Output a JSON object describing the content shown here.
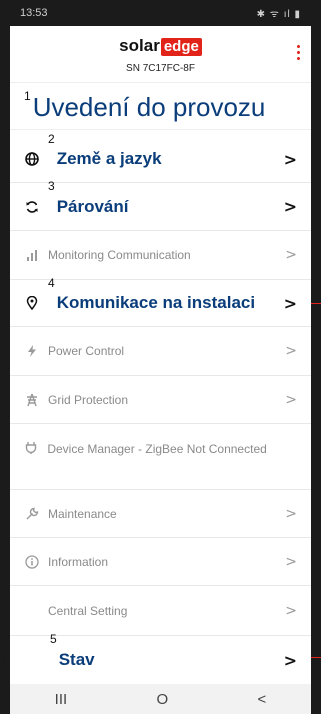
{
  "status_bar": {
    "time": "13:53",
    "icons": "✱ ᯤ ıl ▮"
  },
  "header": {
    "logo_solar": "solar",
    "logo_edge": "edge",
    "serial": "SN 7C17FC-8F"
  },
  "page": {
    "annotation": "1",
    "title": "Uvedení do provozu"
  },
  "menu": {
    "country": {
      "annotation": "2",
      "label": "Země a jazyk"
    },
    "pairing": {
      "annotation": "3",
      "label": "Párování"
    },
    "monitoring": {
      "label": "Monitoring Communication"
    },
    "site_comm": {
      "annotation": "4",
      "label": "Komunikace na instalaci"
    },
    "power_control": {
      "label": "Power Control"
    },
    "grid_protection": {
      "label": "Grid Protection"
    },
    "device_manager": {
      "label": "Device Manager - ZigBee Not Connected"
    },
    "maintenance": {
      "label": "Maintenance"
    },
    "information": {
      "label": "Information"
    },
    "central_setting": {
      "label": "Central Setting"
    },
    "status": {
      "annotation": "5",
      "label": "Stav"
    }
  },
  "nav_bar": {
    "recents": "III",
    "home": "O",
    "back": "<"
  },
  "colors": {
    "accent": "#e2231a",
    "title": "#0a3d7a",
    "muted": "#8a8a8a"
  }
}
